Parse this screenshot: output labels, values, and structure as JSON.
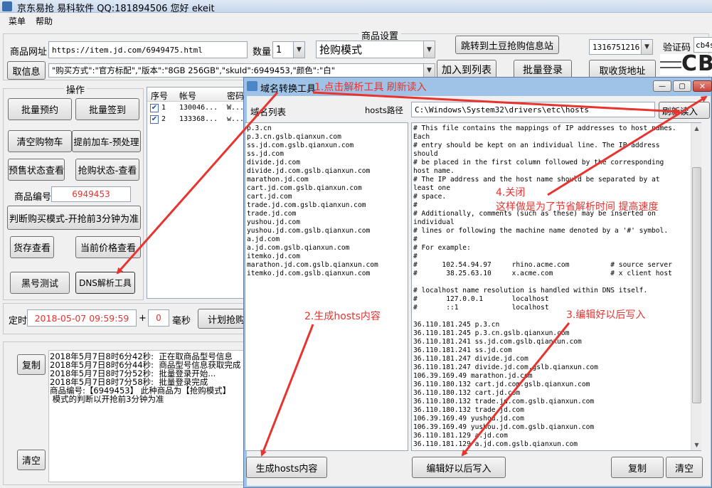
{
  "app": {
    "title": "京东易抢  易科软件 QQ:181894506   您好 ekeit",
    "menu": [
      "菜单",
      "帮助"
    ]
  },
  "main": {
    "goods_group_title": "商品设置",
    "url_label": "商品网址",
    "url_value": "https://item.jd.com/6949475.html",
    "qty_label": "数量",
    "qty_value": "1",
    "mode_value": "抢购模式",
    "jump_button": "跳转到土豆抢购信息站",
    "account_value": "1316751216",
    "captcha_label": "验证码",
    "captcha_value": "cb4s",
    "captcha_image_text": "CB4",
    "fetch_button": "取信息",
    "spec_value": "\"购买方式\":\"官方标配\",\"版本\":\"8GB  256GB\",\"skuId\":6949453,\"颜色\":\"白\"",
    "add_list_button": "加入到列表",
    "batch_login_button": "批量登录",
    "address_button": "取收货地址",
    "ops_title": "操作",
    "buttons": {
      "batch_reserve": "批量预约",
      "batch_sign": "批量签到",
      "clear_cart": "清空购物车",
      "precart": "提前加车-预处理",
      "presale_check": "预售状态查看",
      "rush_check": "抢购状态-查看",
      "judge_mode": "判断购买模式-开抢前3分钟为准",
      "stock_check": "货存查看",
      "price_check": "当前价格查看",
      "blacklist": "黑号测试",
      "dns_tool": "DNS解析工具",
      "copy": "复制",
      "clear": "清空",
      "plan": "计划抢购"
    },
    "product_no_label": "商品编号",
    "product_no_value": "6949453",
    "timer_label": "定时",
    "timer_value": "2018-05-07 09:59:59",
    "timer_plus": "+",
    "ms_value": "0",
    "ms_label": "毫秒",
    "table": {
      "headers": [
        "序号",
        "帐号",
        "密码"
      ],
      "rows": [
        {
          "no": "1",
          "account": "130046...",
          "pwd": "W..."
        },
        {
          "no": "2",
          "account": "133368...",
          "pwd": "w..."
        }
      ]
    },
    "log": [
      "2018年5月7日8时6分42秒:  正在取商品型号信息",
      "2018年5月7日8时6分44秒:  商品型号信息获取完成",
      "2018年5月7日8时7分52秒:  批量登录开始...",
      "2018年5月7日8时7分58秒:  批量登录完成",
      "商品编号:【6949453】 此种商品为【抢购模式】",
      " 模式的判断以开抢前3分钟为准"
    ]
  },
  "dialog": {
    "title": "域名转换工具",
    "list_label": "域名列表",
    "hosts_path_label": "hosts路径",
    "hosts_path_value": "C:\\Windows\\System32\\drivers\\etc\\hosts",
    "refresh_button": "刷新读入",
    "domains": [
      "p.3.cn",
      "p.3.cn.gslb.qianxun.com",
      "ss.jd.com.gslb.qianxun.com",
      "ss.jd.com",
      "divide.jd.com",
      "divide.jd.com.gslb.qianxun.com",
      "marathon.jd.com",
      "cart.jd.com.gslb.qianxun.com",
      "cart.jd.com",
      "trade.jd.com.gslb.qianxun.com",
      "trade.jd.com",
      "yushou.jd.com",
      "yushou.jd.com.gslb.qianxun.com",
      "a.jd.com",
      "a.jd.com.gslb.qianxun.com",
      "itemko.jd.com",
      "marathon.jd.com.gslb.qianxun.com",
      "itemko.jd.com.gslb.qianxun.com"
    ],
    "hosts_lines": [
      "# This file contains the mappings of IP addresses to host names.",
      "Each",
      "# entry should be kept on an individual line. The IP address",
      "should",
      "# be placed in the first column followed by the corresponding",
      "host name.",
      "# The IP address and the host name should be separated by at",
      "least one",
      "# space.",
      "#",
      "# Additionally, comments (such as these) may be inserted on",
      "individual",
      "# lines or following the machine name denoted by a '#' symbol.",
      "#",
      "# For example:",
      "#",
      "#      102.54.94.97     rhino.acme.com          # source server",
      "#       38.25.63.10     x.acme.com              # x client host",
      "",
      "# localhost name resolution is handled within DNS itself.",
      "#       127.0.0.1       localhost",
      "#       ::1             localhost",
      "",
      "36.110.181.245 p.3.cn",
      "36.110.181.245 p.3.cn.gslb.qianxun.com",
      "36.110.181.241 ss.jd.com.gslb.qianxun.com",
      "36.110.181.241 ss.jd.com",
      "36.110.181.247 divide.jd.com",
      "36.110.181.247 divide.jd.com.gslb.qianxun.com",
      "106.39.169.49 marathon.jd.com",
      "36.110.180.132 cart.jd.com.gslb.qianxun.com",
      "36.110.180.132 cart.jd.com",
      "36.110.180.132 trade.jd.com.gslb.qianxun.com",
      "36.110.180.132 trade.jd.com",
      "106.39.169.49 yushou.jd.com",
      "106.39.169.49 yushou.jd.com.gslb.qianxun.com",
      "36.110.181.129 a.jd.com",
      "36.110.181.129 a.jd.com.gslb.qianxun.com"
    ],
    "gen_button": "生成hosts内容",
    "write_button": "编辑好以后写入",
    "copy_button": "复制",
    "clear_button": "清空"
  },
  "annotations": {
    "step1": "1.点击解析工具 刷新读入",
    "step2": "2.生成hosts内容",
    "step3": "3.编辑好以后写入",
    "step4_a": "4.关闭",
    "step4_b": "这样做是为了节省解析时间 提高速度"
  },
  "colors": {
    "annotation": "#e8332f",
    "dialog_title_bar": "#9fc3e6",
    "close_button": "#c9463d"
  }
}
